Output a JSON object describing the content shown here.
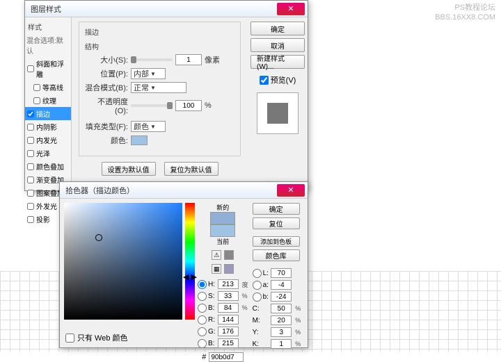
{
  "watermark": {
    "l1": "PS教程论坛",
    "l2": "BBS.16XX8.COM"
  },
  "dlg1": {
    "title": "图层样式",
    "sidebar": {
      "header": "样式",
      "sub": "混合选项:默认",
      "items": [
        {
          "label": "斜面和浮雕",
          "checked": false
        },
        {
          "label": "等高线",
          "checked": false,
          "indent": true
        },
        {
          "label": "纹理",
          "checked": false,
          "indent": true
        },
        {
          "label": "描边",
          "checked": true,
          "active": true
        },
        {
          "label": "内阴影",
          "checked": false
        },
        {
          "label": "内发光",
          "checked": false
        },
        {
          "label": "光泽",
          "checked": false
        },
        {
          "label": "颜色叠加",
          "checked": false
        },
        {
          "label": "渐变叠加",
          "checked": false
        },
        {
          "label": "图案叠加",
          "checked": false
        },
        {
          "label": "外发光",
          "checked": false
        },
        {
          "label": "投影",
          "checked": false
        }
      ]
    },
    "panel": {
      "group_title": "描边",
      "struct_title": "结构",
      "size_label": "大小(S):",
      "size_value": "1",
      "size_unit": "像素",
      "pos_label": "位置(P):",
      "pos_value": "内部",
      "blend_label": "混合模式(B):",
      "blend_value": "正常",
      "opacity_label": "不透明度(O):",
      "opacity_value": "100",
      "opacity_unit": "%",
      "filltype_label": "填充类型(F):",
      "filltype_value": "颜色",
      "color_label": "颜色:",
      "btn_default": "设置为默认值",
      "btn_reset": "复位为默认值"
    },
    "right": {
      "ok": "确定",
      "cancel": "取消",
      "newstyle": "新建样式(W)...",
      "preview_label": "预览(V)"
    }
  },
  "dlg2": {
    "title": "拾色器（描边颜色）",
    "new_label": "新的",
    "current_label": "当前",
    "right": {
      "ok": "确定",
      "cancel": "复位",
      "add": "添加到色板",
      "libs": "颜色库"
    },
    "vals": {
      "H": "213",
      "H_u": "度",
      "S": "33",
      "S_u": "%",
      "B": "84",
      "B_u": "%",
      "R": "144",
      "G": "176",
      "Bv": "215",
      "L": "70",
      "a": "-4",
      "b": "-24",
      "C": "50",
      "M": "20",
      "Y": "3",
      "K": "1",
      "pct": "%"
    },
    "hex_label": "#",
    "hex": "90b0d7",
    "web_label": "只有 Web 颜色"
  },
  "colors": {
    "swatch": "#9fc3e4",
    "new": "#90b0d7",
    "old": "#9fc3e4"
  }
}
